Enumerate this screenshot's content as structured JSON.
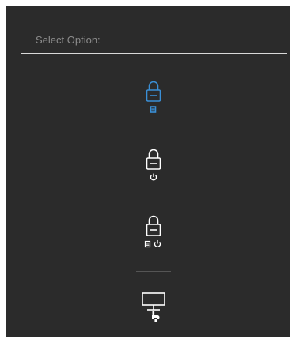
{
  "title": "Select Option:",
  "options": [
    {
      "name": "menu-lock",
      "icon": "lock-menu-icon",
      "selected": true
    },
    {
      "name": "power-lock",
      "icon": "lock-power-icon",
      "selected": false
    },
    {
      "name": "menu-power-lock",
      "icon": "lock-menu-power-icon",
      "selected": false
    },
    {
      "name": "diagnostics",
      "icon": "monitor-wrench-icon",
      "selected": false
    }
  ],
  "colors": {
    "selected": "#3a8fd6",
    "normal": "#ffffff",
    "panel": "#2b2b2b",
    "title": "#8c8c8c"
  }
}
